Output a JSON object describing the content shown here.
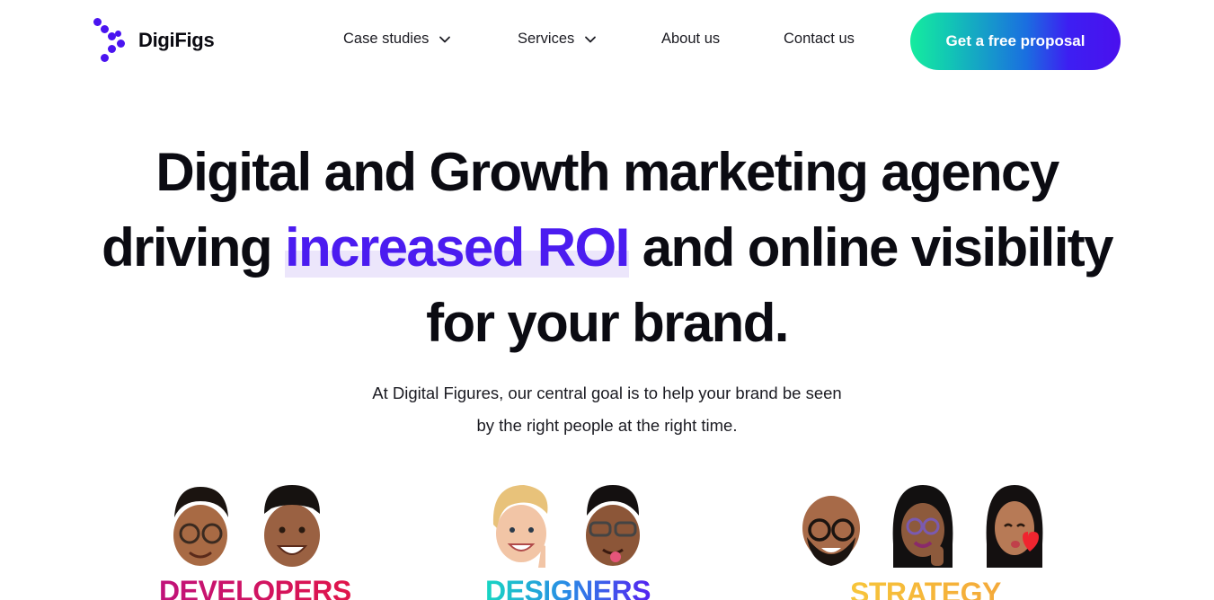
{
  "header": {
    "logo_text": "DigiFigs",
    "nav": {
      "case_studies": "Case studies",
      "services": "Services",
      "about": "About us",
      "contact": "Contact us"
    },
    "cta_label": "Get a free proposal"
  },
  "hero": {
    "line1": "Digital and Growth marketing agency",
    "line2_pre": "driving ",
    "line2_highlight": "increased ROI",
    "line2_post": " and online visibility",
    "line3": "for your brand.",
    "sub_line1": "At Digital Figures, our central goal is to help your brand be seen",
    "sub_line2": "by the right people at the right time."
  },
  "teams": {
    "developers": "DEVELOPERS",
    "designers": "DESIGNERS",
    "strategy": "STRATEGY"
  },
  "colors": {
    "accent": "#4b1cf0",
    "cta_start": "#15ec9e",
    "cta_end": "#4a10ee"
  }
}
